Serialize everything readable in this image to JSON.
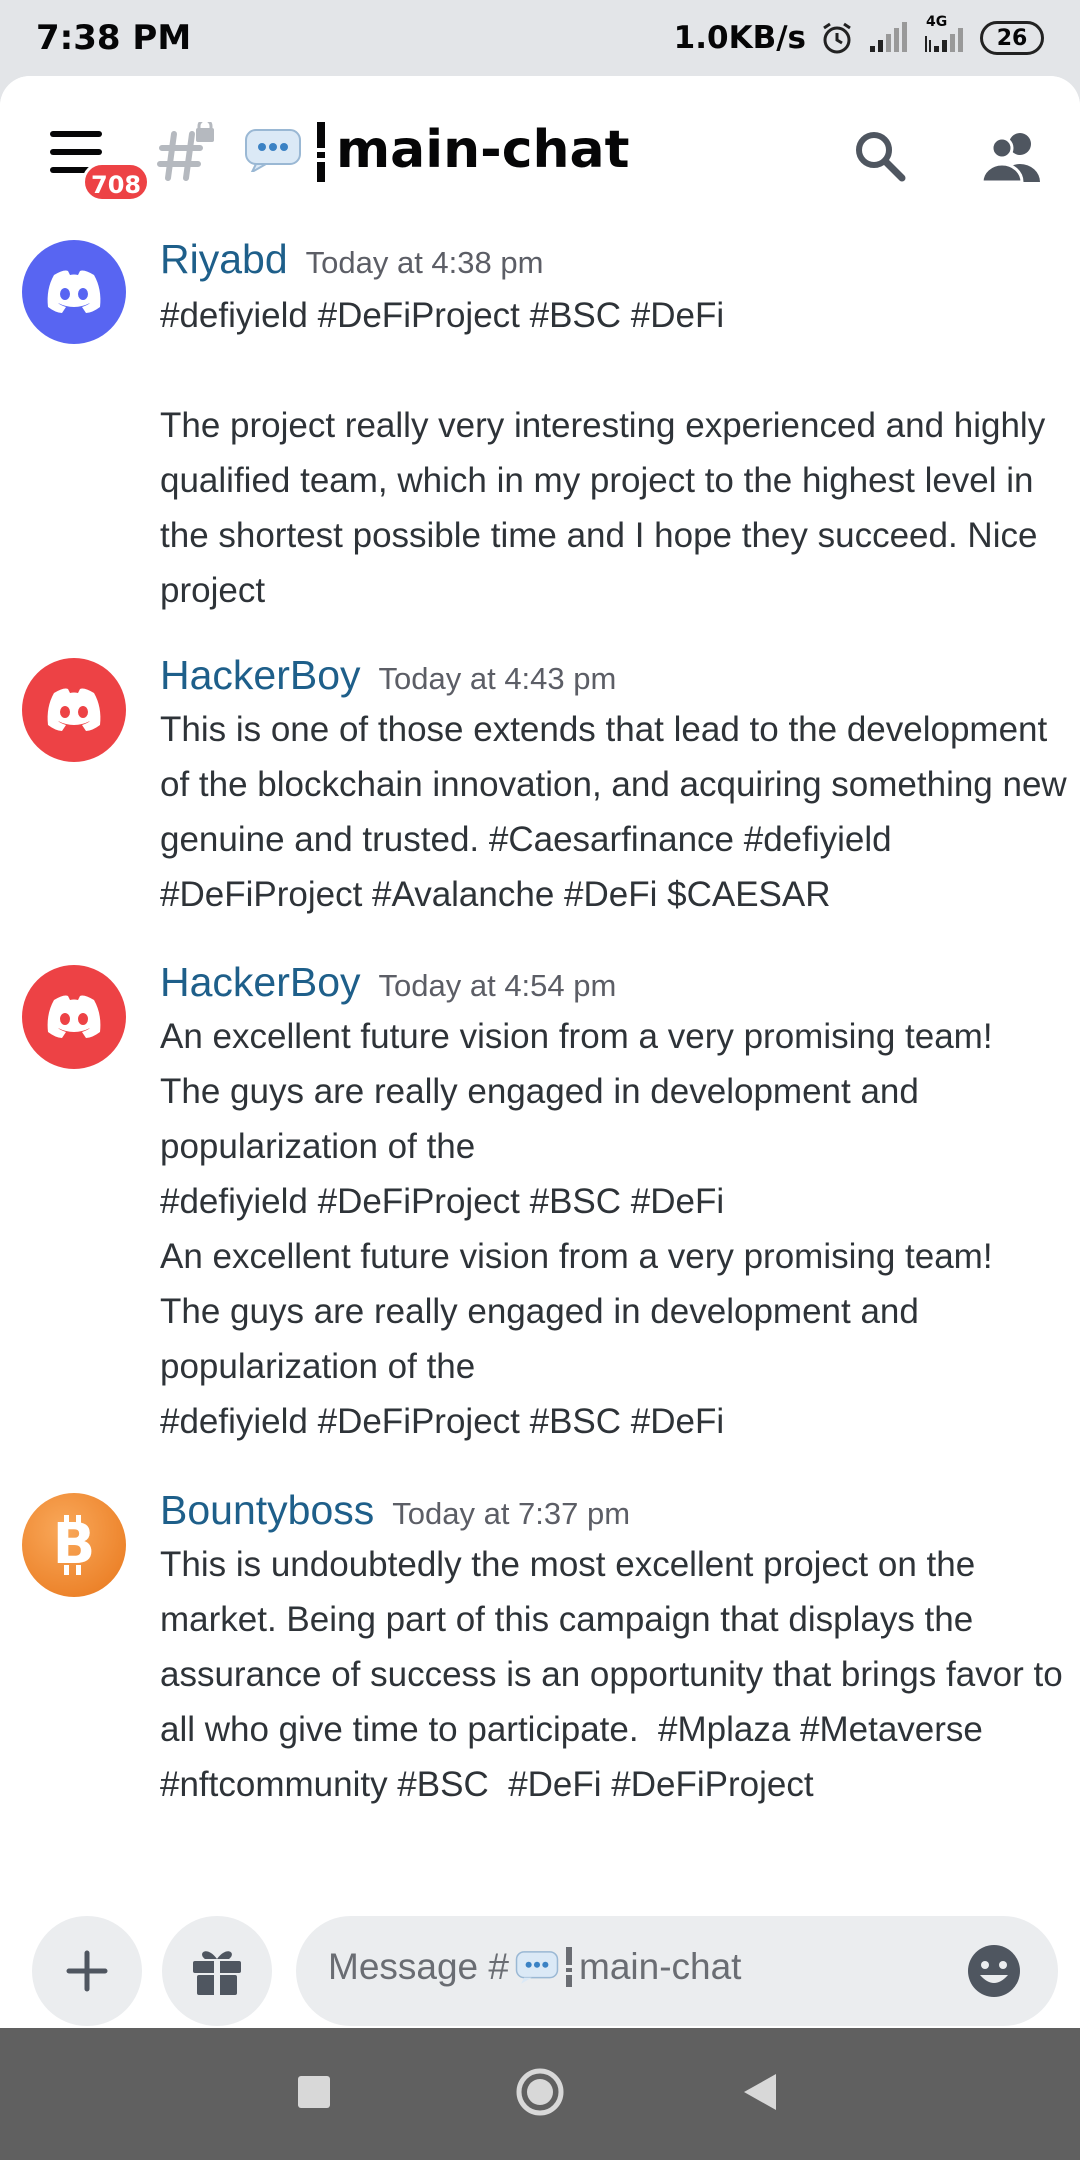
{
  "status_bar": {
    "time": "7:38 PM",
    "network_speed": "1.0KB/s",
    "network_type": "4G",
    "battery": "26"
  },
  "header": {
    "unread_badge": "708",
    "channel_name": "main-chat"
  },
  "messages": [
    {
      "author": "Riyabd",
      "timestamp": "Today at 4:38 pm",
      "avatar": "discord-logo-icon",
      "avatar_color": "#5865f2",
      "body": "#defiyield #DeFiProject #BSC #DeFi\n\nThe project really very interesting experienced and highly qualified team, which in my project to the highest level in the shortest possible time and I hope they succeed. Nice project"
    },
    {
      "author": "HackerBoy",
      "timestamp": "Today at 4:43 pm",
      "avatar": "discord-logo-icon",
      "avatar_color": "#ed4245",
      "body": "This is one of those extends that lead to the development of the blockchain innovation, and acquiring something new genuine and trusted. #Caesarfinance #defiyield #DeFiProject #Avalanche #DeFi $CAESAR"
    },
    {
      "author": "HackerBoy",
      "timestamp": "Today at 4:54 pm",
      "avatar": "discord-logo-icon",
      "avatar_color": "#ed4245",
      "body": "An excellent future vision from a very promising team! The guys are really engaged in development and popularization of the\n#defiyield #DeFiProject #BSC #DeFi\nAn excellent future vision from a very promising team! The guys are really engaged in development and popularization of the\n#defiyield #DeFiProject #BSC #DeFi"
    },
    {
      "author": "Bountyboss",
      "timestamp": "Today at 7:37 pm",
      "avatar": "bitcoin-icon",
      "avatar_color": "#f7931a",
      "body": "This is undoubtedly the most excellent project on the market. Being part of this campaign that displays the assurance of success is an opportunity that brings favor to all who give time to participate.  #Mplaza #Metaverse #nftcommunity #BSC  #DeFi #DeFiProject"
    }
  ],
  "composer": {
    "placeholder_prefix": "Message #",
    "placeholder_channel": "main-chat"
  },
  "colors": {
    "author_link": "#1e5f8a",
    "badge_red": "#ed4245",
    "blurple": "#5865f2"
  }
}
